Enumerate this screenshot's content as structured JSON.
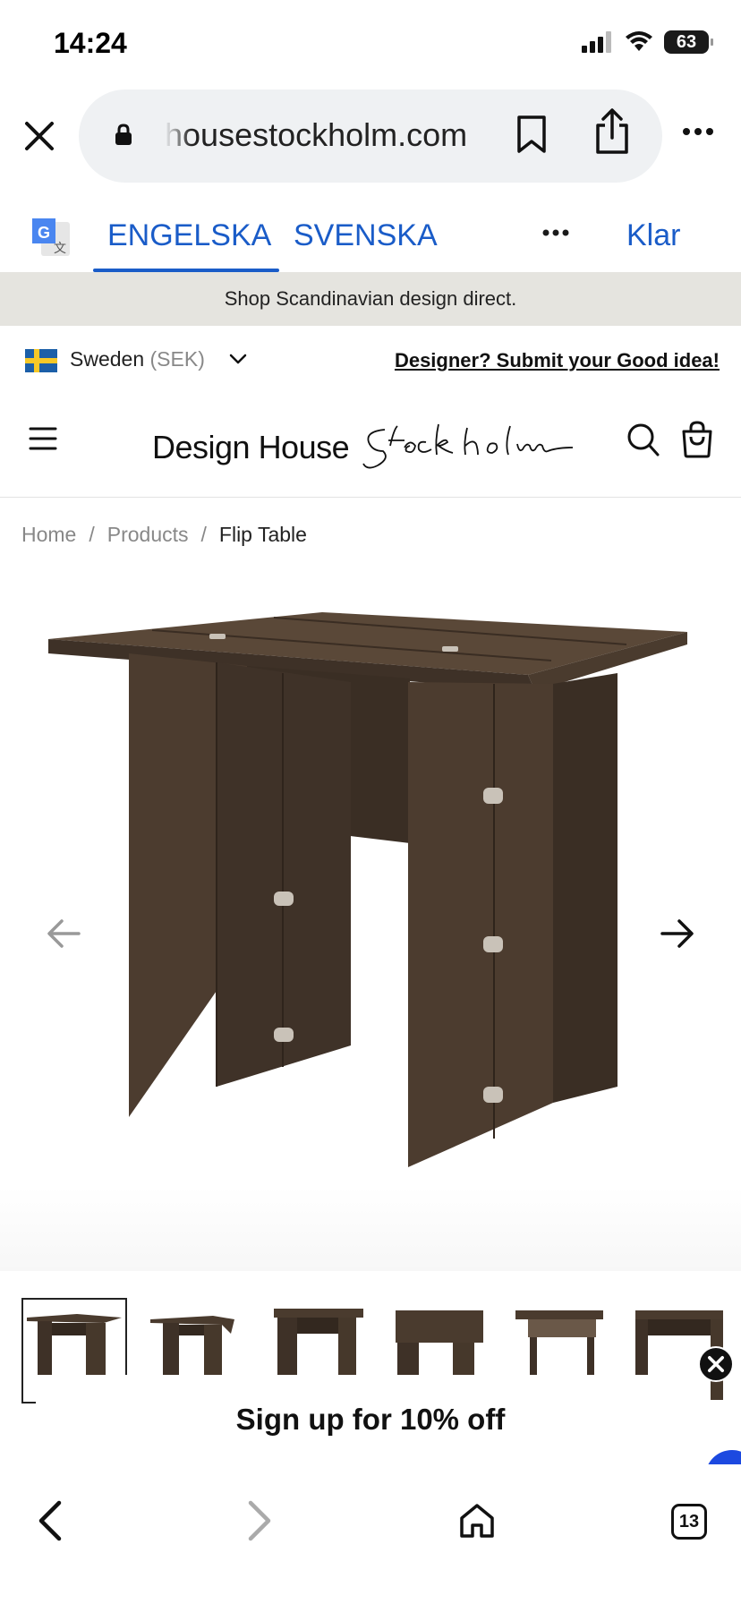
{
  "status_bar": {
    "time": "14:24",
    "battery": "63"
  },
  "browser": {
    "url": "housestockholm.com",
    "close_icon": "close-icon",
    "lock_icon": "lock-icon",
    "bookmark_icon": "bookmark-icon",
    "share_icon": "share-icon",
    "more_icon": "more-icon"
  },
  "translate_bar": {
    "tabs": [
      "ENGELSKA",
      "SVENSKA"
    ],
    "selected_tab": "ENGELSKA",
    "done_label": "Klar",
    "accent_color": "#1a5cc8"
  },
  "promo": {
    "text": "Shop Scandinavian design direct."
  },
  "locale": {
    "country": "Sweden",
    "currency": "(SEK)",
    "designer_link": "Designer? Submit your Good idea!"
  },
  "header": {
    "logo_text": "Design House",
    "logo_script": "Stockholm"
  },
  "breadcrumb": {
    "items": [
      "Home",
      "Products",
      "Flip Table"
    ],
    "separator": "/"
  },
  "gallery": {
    "thumbnail_count": 6,
    "selected_index": 0
  },
  "signup": {
    "text": "Sign up for 10% off"
  },
  "bottom_nav": {
    "tab_count": "13"
  },
  "colors": {
    "promo_bg": "#e5e4df",
    "wood": "#4a3b2e"
  }
}
